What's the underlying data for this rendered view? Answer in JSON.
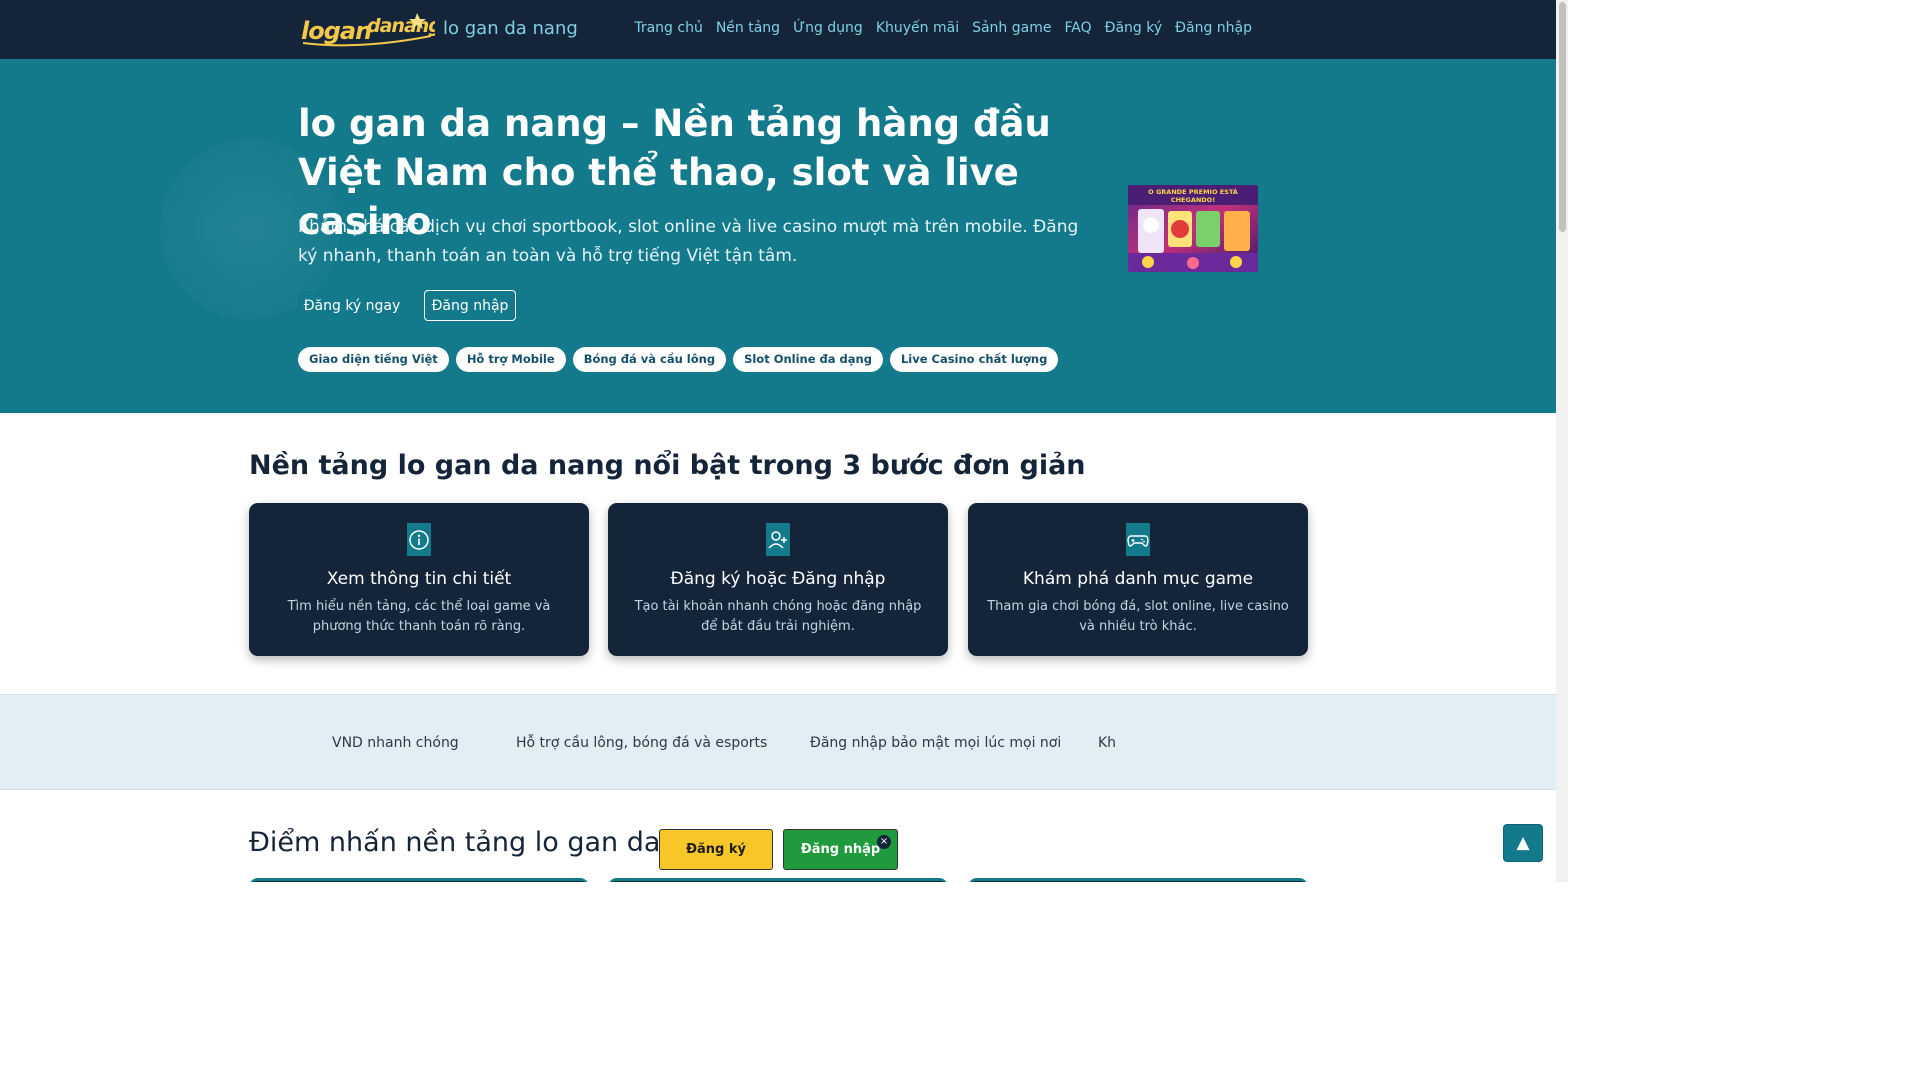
{
  "header": {
    "logo_text": "logandanang",
    "brand_name": "lo gan da nang",
    "nav": [
      "Trang chủ",
      "Nền tảng",
      "Ứng dụng",
      "Khuyến mãi",
      "Sảnh game",
      "FAQ",
      "Đăng ký",
      "Đăng nhập"
    ]
  },
  "hero": {
    "title": "lo gan da nang – Nền tảng hàng đầu Việt Nam cho thể thao, slot và live casino",
    "description": "Khám phá các dịch vụ chơi sportbook, slot online và live casino mượt mà trên mobile. Đăng ký nhanh, thanh toán an toàn và hỗ trợ tiếng Việt tận tâm.",
    "primary_button": "Đăng ký ngay",
    "outline_button": "Đăng nhập",
    "chips": [
      "Giao diện tiếng Việt",
      "Hỗ trợ Mobile",
      "Bóng đá và cầu lông",
      "Slot Online đa dạng",
      "Live Casino chất lượng"
    ],
    "image_caption": "O GRANDE PREMIO ESTÁ CHEGANDO"
  },
  "steps": {
    "title": "Nền tảng lo gan da nang nổi bật trong 3 bước đơn giản",
    "cards": [
      {
        "icon": "info-icon",
        "title": "Xem thông tin chi tiết",
        "text": "Tìm hiểu nền tảng, các thể loại game và phương thức thanh toán rõ ràng."
      },
      {
        "icon": "user-plus-icon",
        "title": "Đăng ký hoặc Đăng nhập",
        "text": "Tạo tài khoản nhanh chóng hoặc đăng nhập để bắt đầu trải nghiệm."
      },
      {
        "icon": "gamepad-icon",
        "title": "Khám phá danh mục game",
        "text": "Tham gia chơi bóng đá, slot online, live casino và nhiều trò khác."
      }
    ]
  },
  "band": {
    "items": [
      "VND nhanh chóng",
      "Hỗ trợ cầu lông, bóng đá và esports",
      "Đăng nhập bảo mật mọi lúc mọi nơi",
      "Kh"
    ]
  },
  "highlights": {
    "title": "Điểm nhấn nền tảng lo gan da n"
  },
  "sticky": {
    "register": "Đăng ký",
    "login": "Đăng nhập",
    "close": "×"
  },
  "to_top": "▲",
  "colors": {
    "header_bg": "#14253a",
    "hero_bg": "#137a8c",
    "accent_yellow": "#f8c629",
    "accent_green": "#1f9a3c"
  }
}
